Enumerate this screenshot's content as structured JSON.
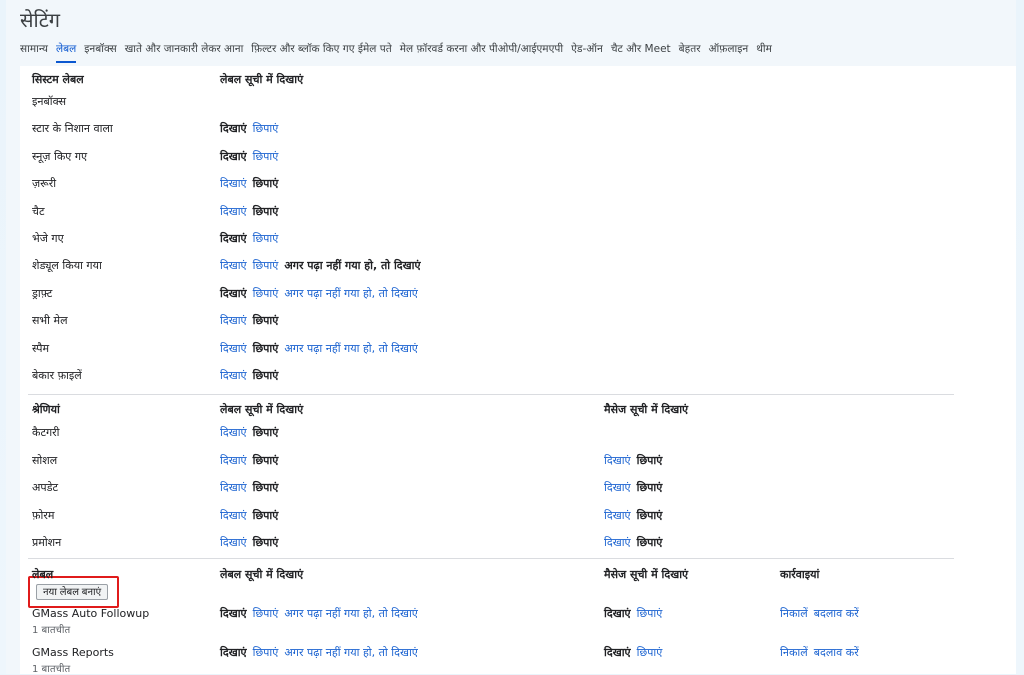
{
  "page": {
    "title": "सेटिंग"
  },
  "tabs": [
    {
      "label": "सामान्य",
      "active": false
    },
    {
      "label": "लेबल",
      "active": true
    },
    {
      "label": "इनबॉक्स",
      "active": false
    },
    {
      "label": "खाते और जानकारी लेकर आना",
      "active": false
    },
    {
      "label": "फ़िल्टर और ब्लॉक किए गए ईमेल पते",
      "active": false
    },
    {
      "label": "मेल फ़ॉरवर्ड करना और पीओपी/आईएमएपी",
      "active": false
    },
    {
      "label": "ऐड-ऑन",
      "active": false
    },
    {
      "label": "चैट और Meet",
      "active": false
    },
    {
      "label": "बेहतर",
      "active": false
    },
    {
      "label": "ऑफ़लाइन",
      "active": false
    },
    {
      "label": "थीम",
      "active": false
    }
  ],
  "system": {
    "header": "सिस्टम लेबल",
    "col_label_list": "लेबल सूची में दिखाएं",
    "rows": [
      {
        "name": "इनबॉक्स",
        "opts": []
      },
      {
        "name": "स्टार के निशान वाला",
        "opts": [
          {
            "t": "दिखाएं",
            "s": true
          },
          {
            "t": "छिपाएं",
            "s": false
          }
        ]
      },
      {
        "name": "स्नूज़ किए गए",
        "opts": [
          {
            "t": "दिखाएं",
            "s": true
          },
          {
            "t": "छिपाएं",
            "s": false
          }
        ]
      },
      {
        "name": "ज़रूरी",
        "opts": [
          {
            "t": "दिखाएं",
            "s": false
          },
          {
            "t": "छिपाएं",
            "s": true
          }
        ]
      },
      {
        "name": "चैट",
        "opts": [
          {
            "t": "दिखाएं",
            "s": false
          },
          {
            "t": "छिपाएं",
            "s": true
          }
        ]
      },
      {
        "name": "भेजे गए",
        "opts": [
          {
            "t": "दिखाएं",
            "s": true
          },
          {
            "t": "छिपाएं",
            "s": false
          }
        ]
      },
      {
        "name": "शेड्यूल किया गया",
        "opts": [
          {
            "t": "दिखाएं",
            "s": false
          },
          {
            "t": "छिपाएं",
            "s": false
          },
          {
            "t": "अगर पढ़ा नहीं गया हो, तो दिखाएं",
            "s": true
          }
        ]
      },
      {
        "name": "ड्राफ़्ट",
        "opts": [
          {
            "t": "दिखाएं",
            "s": true
          },
          {
            "t": "छिपाएं",
            "s": false
          },
          {
            "t": "अगर पढ़ा नहीं गया हो, तो दिखाएं",
            "s": false
          }
        ]
      },
      {
        "name": "सभी मेल",
        "opts": [
          {
            "t": "दिखाएं",
            "s": false
          },
          {
            "t": "छिपाएं",
            "s": true
          }
        ]
      },
      {
        "name": "स्पैम",
        "opts": [
          {
            "t": "दिखाएं",
            "s": false
          },
          {
            "t": "छिपाएं",
            "s": true
          },
          {
            "t": "अगर पढ़ा नहीं गया हो, तो दिखाएं",
            "s": false
          }
        ]
      },
      {
        "name": "बेकार फ़ाइलें",
        "opts": [
          {
            "t": "दिखाएं",
            "s": false
          },
          {
            "t": "छिपाएं",
            "s": true
          }
        ]
      }
    ]
  },
  "categories": {
    "header": "श्रेणियां",
    "col_label_list": "लेबल सूची में दिखाएं",
    "col_message_list": "मैसेज सूची में दिखाएं",
    "rows": [
      {
        "name": "कैटगरी",
        "opts": [
          {
            "t": "दिखाएं",
            "s": false
          },
          {
            "t": "छिपाएं",
            "s": true
          }
        ],
        "msg": []
      },
      {
        "name": "सोशल",
        "opts": [
          {
            "t": "दिखाएं",
            "s": false
          },
          {
            "t": "छिपाएं",
            "s": true
          }
        ],
        "msg": [
          {
            "t": "दिखाएं",
            "s": false
          },
          {
            "t": "छिपाएं",
            "s": true
          }
        ]
      },
      {
        "name": "अपडेट",
        "opts": [
          {
            "t": "दिखाएं",
            "s": false
          },
          {
            "t": "छिपाएं",
            "s": true
          }
        ],
        "msg": [
          {
            "t": "दिखाएं",
            "s": false
          },
          {
            "t": "छिपाएं",
            "s": true
          }
        ]
      },
      {
        "name": "फ़ोरम",
        "opts": [
          {
            "t": "दिखाएं",
            "s": false
          },
          {
            "t": "छिपाएं",
            "s": true
          }
        ],
        "msg": [
          {
            "t": "दिखाएं",
            "s": false
          },
          {
            "t": "छिपाएं",
            "s": true
          }
        ]
      },
      {
        "name": "प्रमोशन",
        "opts": [
          {
            "t": "दिखाएं",
            "s": false
          },
          {
            "t": "छिपाएं",
            "s": true
          }
        ],
        "msg": [
          {
            "t": "दिखाएं",
            "s": false
          },
          {
            "t": "छिपाएं",
            "s": true
          }
        ]
      }
    ]
  },
  "labels": {
    "header": "लेबल",
    "col_label_list": "लेबल सूची में दिखाएं",
    "col_message_list": "मैसेज सूची में दिखाएं",
    "col_actions": "कार्रवाइयां",
    "new_label_button": "नया लेबल बनाएं",
    "rows": [
      {
        "name": "GMass Auto Followup",
        "count": "1 बातचीत",
        "opts": [
          {
            "t": "दिखाएं",
            "s": true
          },
          {
            "t": "छिपाएं",
            "s": false
          },
          {
            "t": "अगर पढ़ा नहीं गया हो, तो दिखाएं",
            "s": false
          }
        ],
        "msg": [
          {
            "t": "दिखाएं",
            "s": true
          },
          {
            "t": "छिपाएं",
            "s": false
          }
        ],
        "actions": [
          "निकालें",
          "बदलाव करें"
        ]
      },
      {
        "name": "GMass Reports",
        "count": "1 बातचीत",
        "opts": [
          {
            "t": "दिखाएं",
            "s": true
          },
          {
            "t": "छिपाएं",
            "s": false
          },
          {
            "t": "अगर पढ़ा नहीं गया हो, तो दिखाएं",
            "s": false
          }
        ],
        "msg": [
          {
            "t": "दिखाएं",
            "s": true
          },
          {
            "t": "छिपाएं",
            "s": false
          }
        ],
        "actions": [
          "निकालें",
          "बदलाव करें"
        ]
      }
    ]
  }
}
